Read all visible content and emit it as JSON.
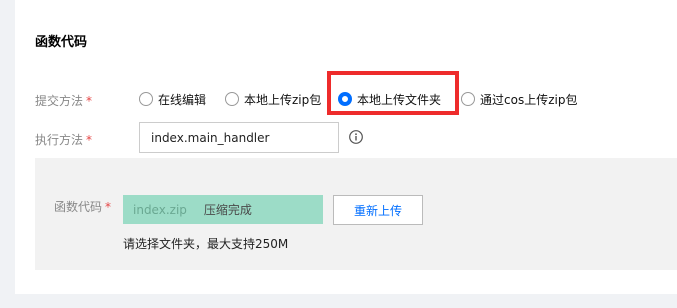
{
  "section": {
    "title": "函数代码"
  },
  "submit_method": {
    "label": "提交方法",
    "required_mark": "*",
    "options": [
      {
        "label": "在线编辑",
        "checked": false
      },
      {
        "label": "本地上传zip包",
        "checked": false
      },
      {
        "label": "本地上传文件夹",
        "checked": true
      },
      {
        "label": "通过cos上传zip包",
        "checked": false
      }
    ]
  },
  "exec_method": {
    "label": "执行方法",
    "required_mark": "*",
    "value": "index.main_handler",
    "info_icon": "info-circle-icon"
  },
  "function_code": {
    "label": "函数代码",
    "required_mark": "*",
    "file_name": "index.zip",
    "file_status": "压缩完成",
    "reupload_label": "重新上传",
    "hint": "请选择文件夹，最大支持250M"
  },
  "colors": {
    "accent": "#006eff",
    "highlight": "#ee2b2b",
    "file_bg": "#9cdcc7",
    "required": "#e54545"
  }
}
